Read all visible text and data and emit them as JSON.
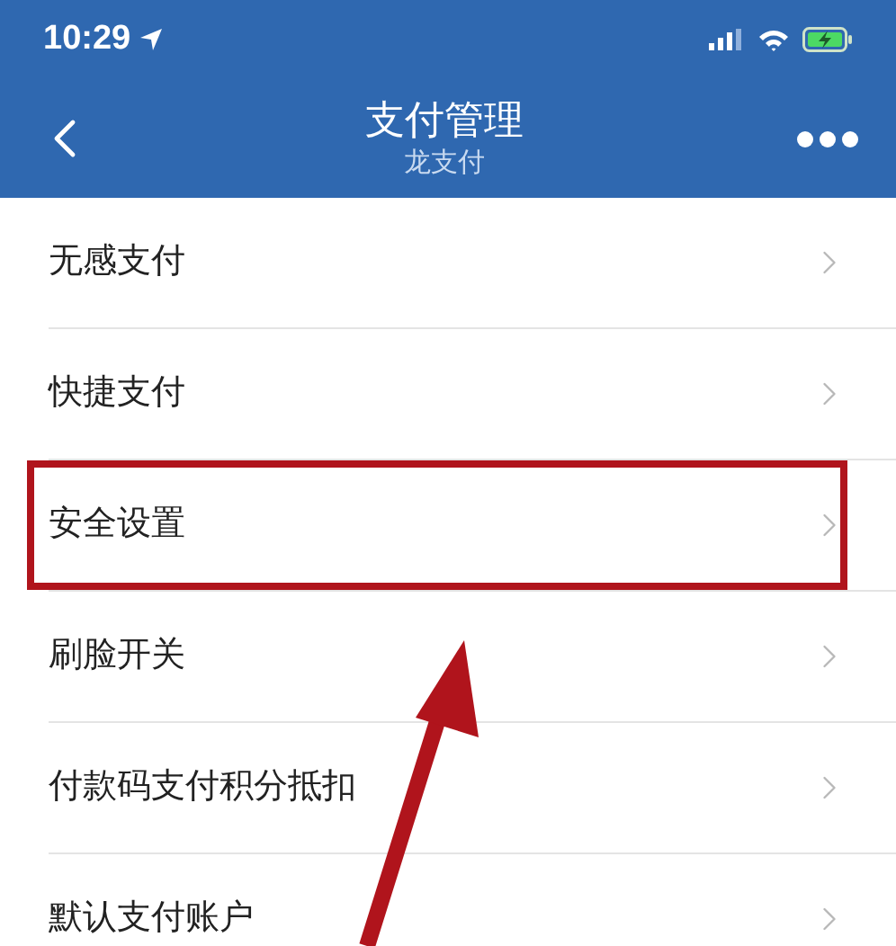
{
  "status_bar": {
    "time": "10:29",
    "battery_charging": true
  },
  "nav": {
    "title": "支付管理",
    "subtitle": "龙支付"
  },
  "items": [
    {
      "label": "无感支付",
      "highlighted": false
    },
    {
      "label": "快捷支付",
      "highlighted": false
    },
    {
      "label": "安全设置",
      "highlighted": true
    },
    {
      "label": "刷脸开关",
      "highlighted": false
    },
    {
      "label": "付款码支付积分抵扣",
      "highlighted": false
    },
    {
      "label": "默认支付账户",
      "highlighted": false
    }
  ],
  "pointer_arrow": true
}
